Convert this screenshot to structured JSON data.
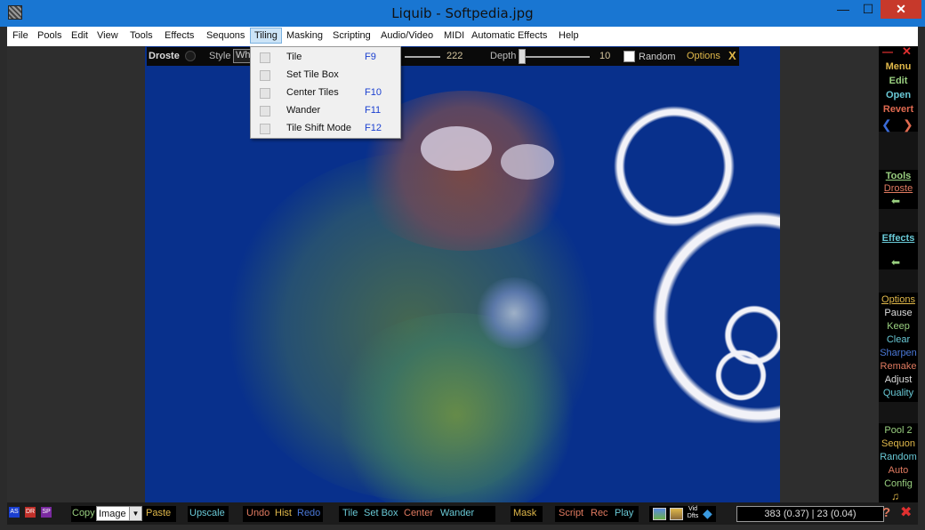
{
  "window": {
    "title": "Liquib - Softpedia.jpg"
  },
  "menu": [
    "File",
    "Pools",
    "Edit",
    "View",
    "Tools",
    "Effects",
    "Sequons",
    "Tiling",
    "Masking",
    "Scripting",
    "Audio/Video",
    "MIDI",
    "Automatic Effects",
    "Help"
  ],
  "menu_active": "Tiling",
  "tiling_menu": [
    {
      "label": "Tile",
      "key": "F9"
    },
    {
      "label": "Set Tile Box",
      "key": ""
    },
    {
      "label": "Center Tiles",
      "key": "F10"
    },
    {
      "label": "Wander",
      "key": "F11"
    },
    {
      "label": "Tile Shift Mode",
      "key": "F12"
    }
  ],
  "effect_bar": {
    "effect": "Droste",
    "style_label": "Style",
    "style_value": "Wh",
    "amount_value": "222",
    "depth_label": "Depth",
    "depth_value": "10",
    "random_label": "Random",
    "options_label": "Options",
    "close_label": "X"
  },
  "right_panel": {
    "top": [
      "Menu",
      "Edit",
      "Open",
      "Revert"
    ],
    "tools": {
      "title": "Tools",
      "item": "Droste"
    },
    "effects": {
      "title": "Effects"
    },
    "options": [
      "Options",
      "Pause",
      "Keep",
      "Clear",
      "Sharpen",
      "Remake",
      "Adjust",
      "Quality"
    ],
    "pool": [
      "Pool 2",
      "Sequon",
      "Random",
      "Auto",
      "Config"
    ]
  },
  "bottom_bar": {
    "badges": [
      "AS",
      "DR",
      "SP"
    ],
    "copy": "Copy",
    "image_select": "Image",
    "paste": "Paste",
    "upscale": "Upscale",
    "undo": "Undo",
    "hist": "Hist",
    "redo": "Redo",
    "tile": "Tile",
    "setbox": "Set Box",
    "center": "Center",
    "wander": "Wander",
    "mask": "Mask",
    "script": "Script",
    "rec": "Rec",
    "play": "Play",
    "vid": "Vid Dfts",
    "coords": "383 (0.37) | 23 (0.04)",
    "help": "?"
  },
  "colors": {
    "accent": "#1976d2",
    "image_bg": "#08308c",
    "gold": "#e0b84a",
    "cyan": "#69c9d6"
  }
}
